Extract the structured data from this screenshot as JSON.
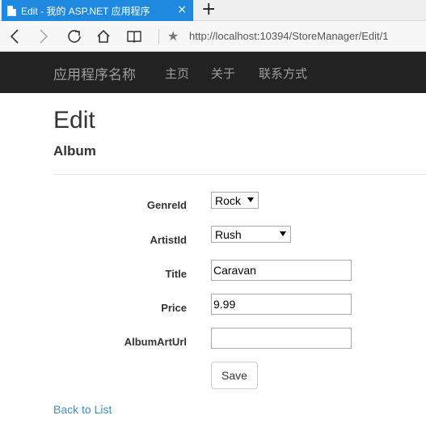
{
  "browser": {
    "tab_title": "Edit - 我的 ASP.NET 应用程序",
    "tab_close": "×",
    "new_tab": "+",
    "url": "http://localhost:10394/StoreManager/Edit/1"
  },
  "site_nav": {
    "brand": "应用程序名称",
    "links": [
      "主页",
      "关于",
      "联系方式"
    ]
  },
  "page": {
    "title": "Edit",
    "subtitle": "Album"
  },
  "form": {
    "genre_label": "GenreId",
    "genre_value": "Rock",
    "artist_label": "ArtistId",
    "artist_value": "Rush",
    "title_label": "Title",
    "title_value": "Caravan",
    "price_label": "Price",
    "price_value": "9.99",
    "albumart_label": "AlbumArtUrl",
    "albumart_value": "",
    "save_label": "Save"
  },
  "back_link": "Back to List"
}
